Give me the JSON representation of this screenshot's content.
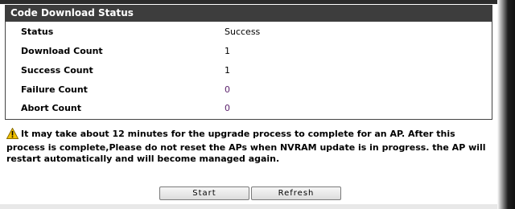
{
  "panel": {
    "title": "Code Download Status",
    "rows": [
      {
        "label": "Status",
        "value": "Success"
      },
      {
        "label": "Download Count",
        "value": "1"
      },
      {
        "label": "Success Count",
        "value": "1"
      },
      {
        "label": "Failure Count",
        "value": "0"
      },
      {
        "label": "Abort Count",
        "value": "0"
      }
    ]
  },
  "notice": {
    "icon": "warning-icon",
    "text": "It may take about 12 minutes for the upgrade process to complete for an AP. After this process is complete,Please do not reset the APs when NVRAM update is in progress. the AP will restart automatically and will become managed again."
  },
  "buttons": {
    "start_label": "Start",
    "refresh_label": "Refresh"
  },
  "colors": {
    "header_bg": "#3d3d3d",
    "purple_value": "#5a1f6b",
    "warning_yellow": "#f2c200"
  }
}
